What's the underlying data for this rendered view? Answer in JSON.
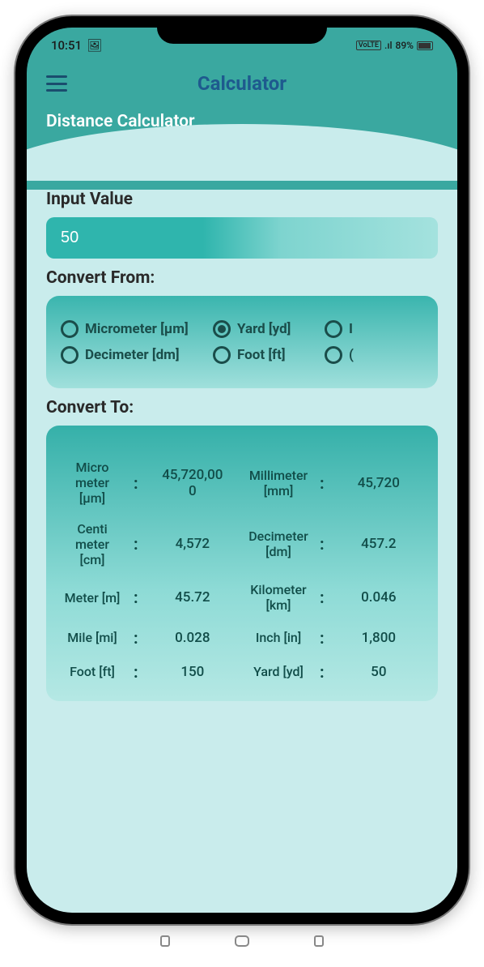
{
  "status": {
    "time": "10:51",
    "gallery_icon": "🖼",
    "network": "VoLTE",
    "signal": "📶",
    "battery_pct": "89%",
    "battery_icon": "▮"
  },
  "app": {
    "title": "Calculator",
    "section_title": "Distance Calculator"
  },
  "input": {
    "label": "Input Value",
    "value": "50"
  },
  "from": {
    "label": "Convert From:",
    "options": [
      {
        "label": "Micrometer [μm]",
        "selected": false
      },
      {
        "label": "Yard [yd]",
        "selected": true
      },
      {
        "label": "I",
        "selected": false
      },
      {
        "label": "Decimeter [dm]",
        "selected": false
      },
      {
        "label": "Foot [ft]",
        "selected": false
      },
      {
        "label": "(",
        "selected": false
      }
    ]
  },
  "to": {
    "label": "Convert To:",
    "results": [
      {
        "unit": "Micrometer [μm]",
        "value": "45,720,000"
      },
      {
        "unit": "Millimeter [mm]",
        "value": "45,720"
      },
      {
        "unit": "Centimeter [cm]",
        "value": "4,572"
      },
      {
        "unit": "Decimeter [dm]",
        "value": "457.2"
      },
      {
        "unit": "Meter [m]",
        "value": "45.72"
      },
      {
        "unit": "Kilometer [km]",
        "value": "0.046"
      },
      {
        "unit": "Mile [mi]",
        "value": "0.028"
      },
      {
        "unit": "Inch [in]",
        "value": "1,800"
      },
      {
        "unit": "Foot [ft]",
        "value": "150"
      },
      {
        "unit": "Yard [yd]",
        "value": "50"
      }
    ]
  }
}
